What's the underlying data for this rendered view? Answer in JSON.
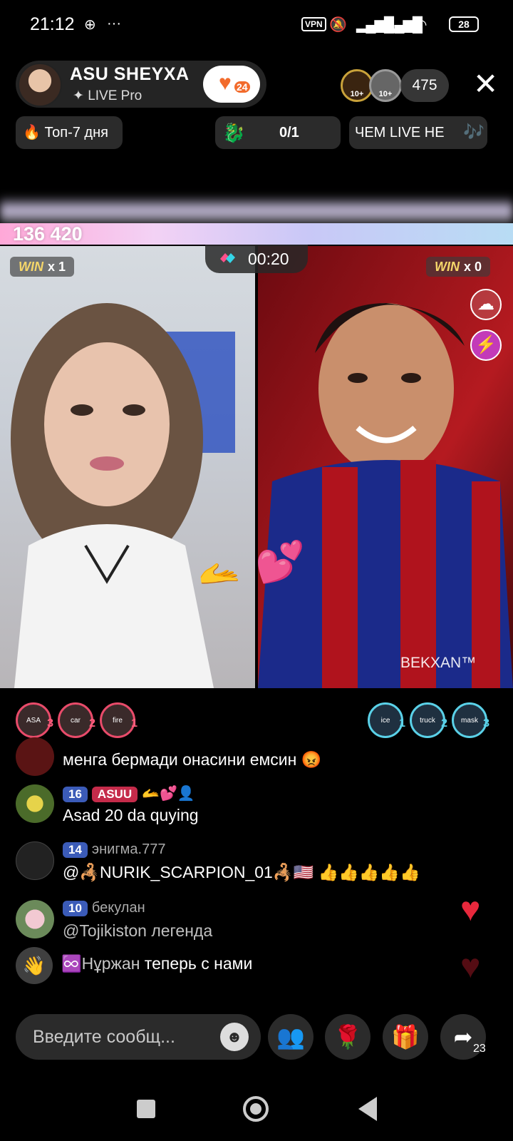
{
  "status_bar": {
    "time": "21:12",
    "vpn": "VPN",
    "battery": "28"
  },
  "host": {
    "name": "ASU SHEYXA",
    "badge": "✦ LIVE Pro",
    "likes_badge": "24"
  },
  "viewers": {
    "badge_1": "10+",
    "badge_2": "10+",
    "count": "475"
  },
  "chips": {
    "ranking": "🔥 Топ-7 дня",
    "goal": "0/1",
    "promo": "ЧЕМ LIVE  НЕ"
  },
  "battle": {
    "score_left": "136 420",
    "timer": "00:20",
    "left_win_label": "WIN",
    "left_win_count": "x 1",
    "right_win_label": "WIN",
    "right_win_count": "x 0",
    "right_name": "BEKXAN™"
  },
  "supporters_left": [
    {
      "label": "ASA",
      "rank": "3"
    },
    {
      "label": "car",
      "rank": "2"
    },
    {
      "label": "fire",
      "rank": "1"
    }
  ],
  "supporters_right": [
    {
      "label": "ice",
      "rank": "1"
    },
    {
      "label": "truck",
      "rank": "2"
    },
    {
      "label": "mask",
      "rank": "3"
    }
  ],
  "chat": [
    {
      "meta": "",
      "text": "менга бермади онасини емсин 😡"
    },
    {
      "level": "16",
      "fan_badge": "ASUU",
      "meta": "",
      "text": "Asad 20 da quying"
    },
    {
      "level": "14",
      "meta": "энигма.777",
      "text": "@🦂NURIK_SCARPION_01🦂🇺🇸 👍👍👍👍👍"
    },
    {
      "level": "10",
      "meta": "бекулан",
      "text": "@Tojikiston  легенда"
    }
  ],
  "join_notice": {
    "name": "♾️Нұржан",
    "text": " теперь с нами"
  },
  "input": {
    "placeholder": "Введите сообщ..."
  },
  "share_count": "23",
  "colors": {
    "accent_pink": "#ff5f7e",
    "accent_blue": "#5ad1e8",
    "heart_red": "#e8283c",
    "like_orange": "#f26b2c"
  }
}
